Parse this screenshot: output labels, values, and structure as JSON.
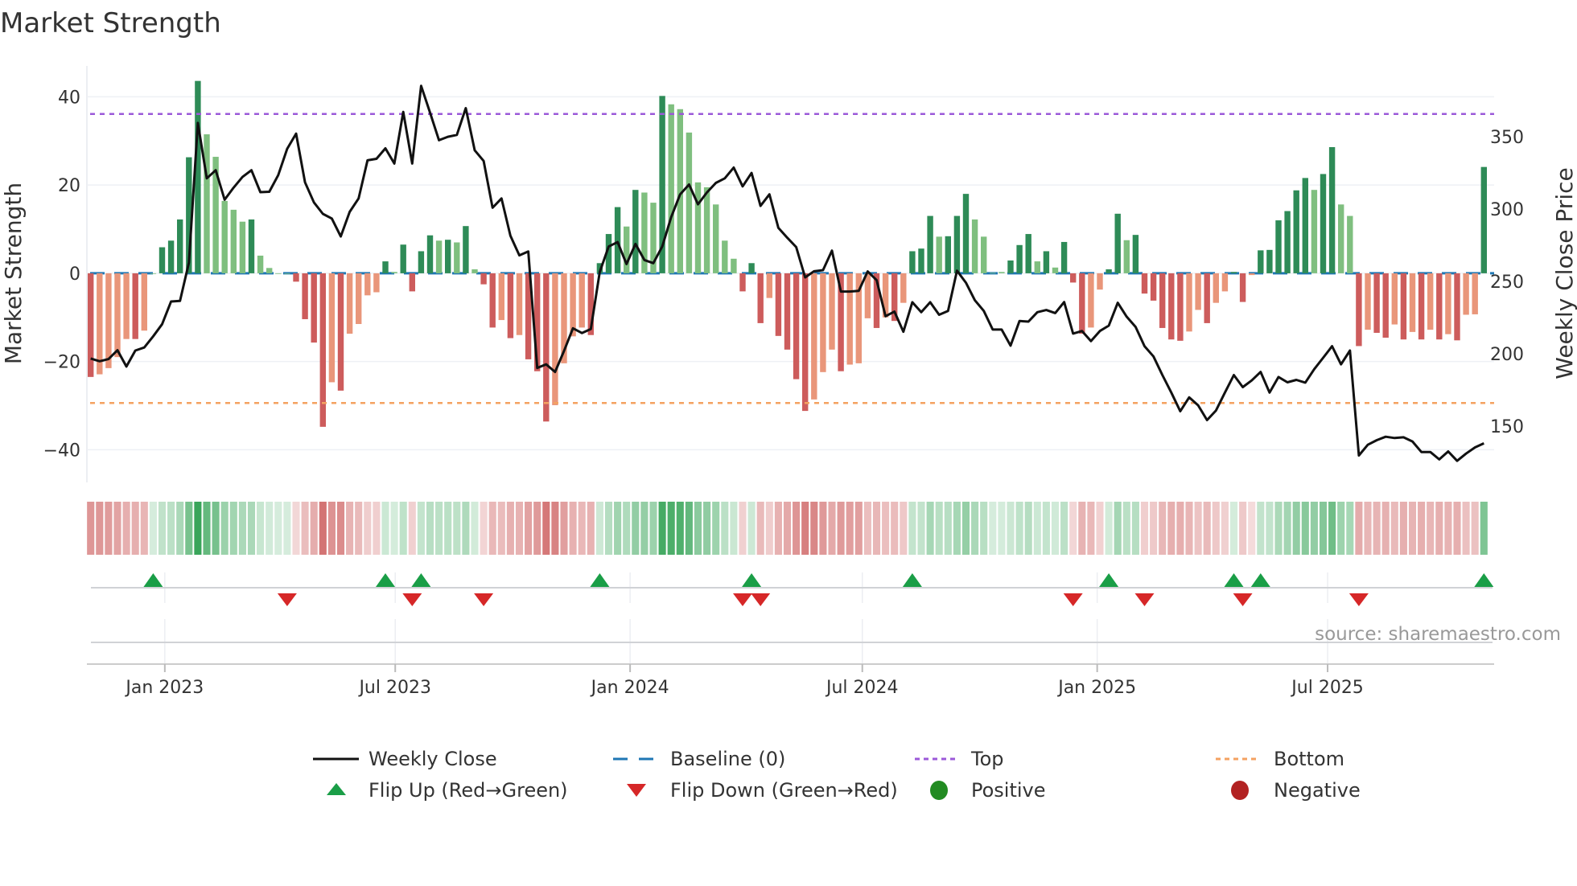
{
  "chart_data": {
    "type": "bar",
    "title": "Market Strength",
    "ylabel": "Market Strength",
    "y2label": "Weekly Close Price",
    "ylim": [
      -47.4,
      47
    ],
    "y2lim": [
      111,
      399
    ],
    "yticks": [
      -40,
      -20,
      0,
      20,
      40
    ],
    "y2ticks": [
      150,
      200,
      250,
      300,
      350
    ],
    "grid": true,
    "x_unit": "week index (0 = first week shown, ~early Nov 2022)",
    "xticks": [
      {
        "label": "Jan 2023",
        "week": 8.3
      },
      {
        "label": "Jul 2023",
        "week": 34.1
      },
      {
        "label": "Jan 2024",
        "week": 60.4
      },
      {
        "label": "Jul 2024",
        "week": 86.4
      },
      {
        "label": "Jan 2025",
        "week": 112.7
      },
      {
        "label": "Jul 2025",
        "week": 138.5
      }
    ],
    "top_level": 36.1,
    "bottom_level": -29.4,
    "baseline": 0,
    "strength": [
      -23.5,
      -22.9,
      -21.5,
      -19,
      -14.9,
      -14.9,
      -13,
      0,
      5.9,
      7.4,
      12.2,
      26.3,
      43.6,
      31.5,
      26.4,
      16.4,
      14.4,
      11.7,
      12.2,
      4,
      1.2,
      0,
      0,
      -1.9,
      -10.4,
      -15.7,
      -34.8,
      -24.7,
      -26.6,
      -13.7,
      -11.5,
      -5,
      -4.3,
      2.7,
      0.3,
      6.5,
      -4.1,
      5,
      8.6,
      7.4,
      7.6,
      7,
      10.7,
      0.9,
      -2.5,
      -12.3,
      -10.6,
      -14.7,
      -14,
      -19.5,
      -22.2,
      -33.6,
      -29.9,
      -20.4,
      -14.3,
      -12.3,
      -14,
      2.3,
      8.9,
      15,
      10.6,
      18.9,
      18.3,
      16,
      40.2,
      38.3,
      37.2,
      31.9,
      20.6,
      19.5,
      15.6,
      7.4,
      3.3,
      -4.1,
      2.3,
      -11.3,
      -5.6,
      -14.2,
      -17.3,
      -24,
      -31.2,
      -28.6,
      -22.4,
      -17.3,
      -22.2,
      -20.7,
      -20.4,
      -10.2,
      -12.4,
      -10,
      -10.8,
      -6.7,
      5,
      5.6,
      13,
      8.3,
      8.4,
      13,
      18,
      12.2,
      8.3,
      0.1,
      0.3,
      2.9,
      6.4,
      8.9,
      2.7,
      5,
      1.3,
      7.1,
      -2.1,
      -13.7,
      -12.3,
      -3.7,
      0.9,
      13.5,
      7.5,
      8.7,
      -4.6,
      -6.2,
      -12.4,
      -15,
      -15.3,
      -13.2,
      -8.3,
      -11.3,
      -6.7,
      -4.1,
      0.3,
      -6.5,
      -0.4,
      5.2,
      5.3,
      12,
      14.1,
      18.8,
      21.6,
      18.9,
      22.5,
      28.6,
      15.6,
      13,
      -16.5,
      -12.8,
      -13.5,
      -14.6,
      -11.6,
      -15,
      -13.3,
      -15,
      -12.8,
      -15,
      -13.8,
      -15.2,
      -9.4,
      -9.3,
      24.1
    ],
    "strengthening": [
      1,
      0,
      0,
      0,
      0,
      1,
      0,
      0,
      1,
      1,
      1,
      1,
      1,
      0,
      0,
      0,
      0,
      0,
      1,
      0,
      0,
      0,
      0,
      1,
      1,
      1,
      1,
      0,
      1,
      0,
      0,
      0,
      0,
      1,
      0,
      1,
      1,
      1,
      1,
      0,
      1,
      0,
      1,
      0,
      1,
      1,
      0,
      1,
      0,
      1,
      1,
      1,
      0,
      0,
      0,
      0,
      1,
      1,
      1,
      1,
      0,
      1,
      0,
      0,
      1,
      0,
      0,
      0,
      0,
      0,
      0,
      0,
      0,
      1,
      1,
      1,
      0,
      1,
      1,
      1,
      1,
      0,
      0,
      0,
      1,
      0,
      0,
      0,
      1,
      0,
      1,
      0,
      1,
      1,
      1,
      0,
      1,
      1,
      1,
      0,
      0,
      0,
      0,
      1,
      1,
      1,
      0,
      1,
      0,
      1,
      1,
      1,
      0,
      0,
      1,
      1,
      0,
      1,
      1,
      1,
      1,
      1,
      1,
      0,
      0,
      1,
      0,
      0,
      1,
      1,
      0,
      1,
      1,
      1,
      1,
      1,
      1,
      0,
      1,
      1,
      0,
      0,
      1,
      0,
      1,
      1,
      0,
      1,
      0,
      1,
      0,
      1,
      0,
      1,
      0,
      0,
      1
    ],
    "weekly_close": [
      196.7,
      194.8,
      196.3,
      202.4,
      191.1,
      202.2,
      204.3,
      212,
      220.4,
      236.1,
      236.5,
      263,
      359.6,
      321.3,
      326.9,
      306.5,
      314.8,
      322.2,
      326.9,
      311.7,
      312,
      323.5,
      341.7,
      352.2,
      318.5,
      304.6,
      296.7,
      293.5,
      281.1,
      298.1,
      307.4,
      333.7,
      334.8,
      342,
      331.5,
      367.2,
      331.5,
      385.2,
      366.7,
      347.6,
      350,
      351.3,
      369.8,
      340.7,
      333.3,
      300.9,
      307.4,
      281.5,
      268,
      270.7,
      190.2,
      192.6,
      187.4,
      201.9,
      217.6,
      214.3,
      217,
      256.5,
      274.1,
      277.2,
      262,
      275.9,
      264.8,
      262.6,
      274.1,
      294.4,
      310.2,
      317,
      303.3,
      311.5,
      318.1,
      321.3,
      328.7,
      315.7,
      325,
      302.2,
      310.2,
      287,
      280.2,
      273.7,
      252.8,
      257,
      257.8,
      271.3,
      243,
      243,
      243.5,
      256.9,
      250.9,
      225.9,
      229.1,
      215.2,
      235.6,
      228.7,
      235.6,
      226.9,
      229.6,
      257.4,
      249.1,
      237,
      229.6,
      216.7,
      216.7,
      205.6,
      222.6,
      222.2,
      228.7,
      230.2,
      228.1,
      235.7,
      213.9,
      215.7,
      208.7,
      215.7,
      219.4,
      235.2,
      225.6,
      218.5,
      205.2,
      198.1,
      185.2,
      173.1,
      160.2,
      169.8,
      164.3,
      154.1,
      160.7,
      173.1,
      185.2,
      176.9,
      181.5,
      187.4,
      173.1,
      183.9,
      180.2,
      181.9,
      180,
      189.3,
      197.2,
      205.2,
      192.6,
      202.2,
      129.6,
      137,
      140.2,
      142.6,
      141.7,
      142.2,
      139.3,
      132,
      132,
      126.9,
      132.4,
      125.9,
      130.9,
      135.2,
      138
    ],
    "flip_up_weeks": [
      7,
      33,
      37,
      57,
      74,
      92,
      114,
      128,
      131,
      156
    ],
    "flip_down_weeks": [
      22,
      36,
      44,
      73,
      75,
      110,
      118,
      129,
      142
    ],
    "legend": {
      "placement": "bottom",
      "items": [
        {
          "label": "Weekly Close",
          "symbol": "line"
        },
        {
          "label": "Baseline (0)",
          "symbol": "dash"
        },
        {
          "label": "Top",
          "symbol": "dot"
        },
        {
          "label": "Bottom",
          "symbol": "dot"
        },
        {
          "label": "Flip Up (Red→Green)",
          "symbol": "triangle-up"
        },
        {
          "label": "Flip Down (Green→Red)",
          "symbol": "triangle-down"
        },
        {
          "label": "Positive",
          "symbol": "circle"
        },
        {
          "label": "Negative",
          "symbol": "circle"
        }
      ]
    },
    "colors": {
      "pos_strong": "#2e8b57",
      "pos_weak": "#7fbf7f",
      "neg_strong": "#cd5c5c",
      "neg_weak": "#e9967a",
      "price": "#111111",
      "baseline": "#1f77b4",
      "top": "#9b59d9",
      "bottom": "#f4a261",
      "flip_up": "#1a9e47",
      "flip_down": "#d62728",
      "positive": "#228b22",
      "negative": "#b22222"
    },
    "source": "source: sharemaestro.com"
  }
}
